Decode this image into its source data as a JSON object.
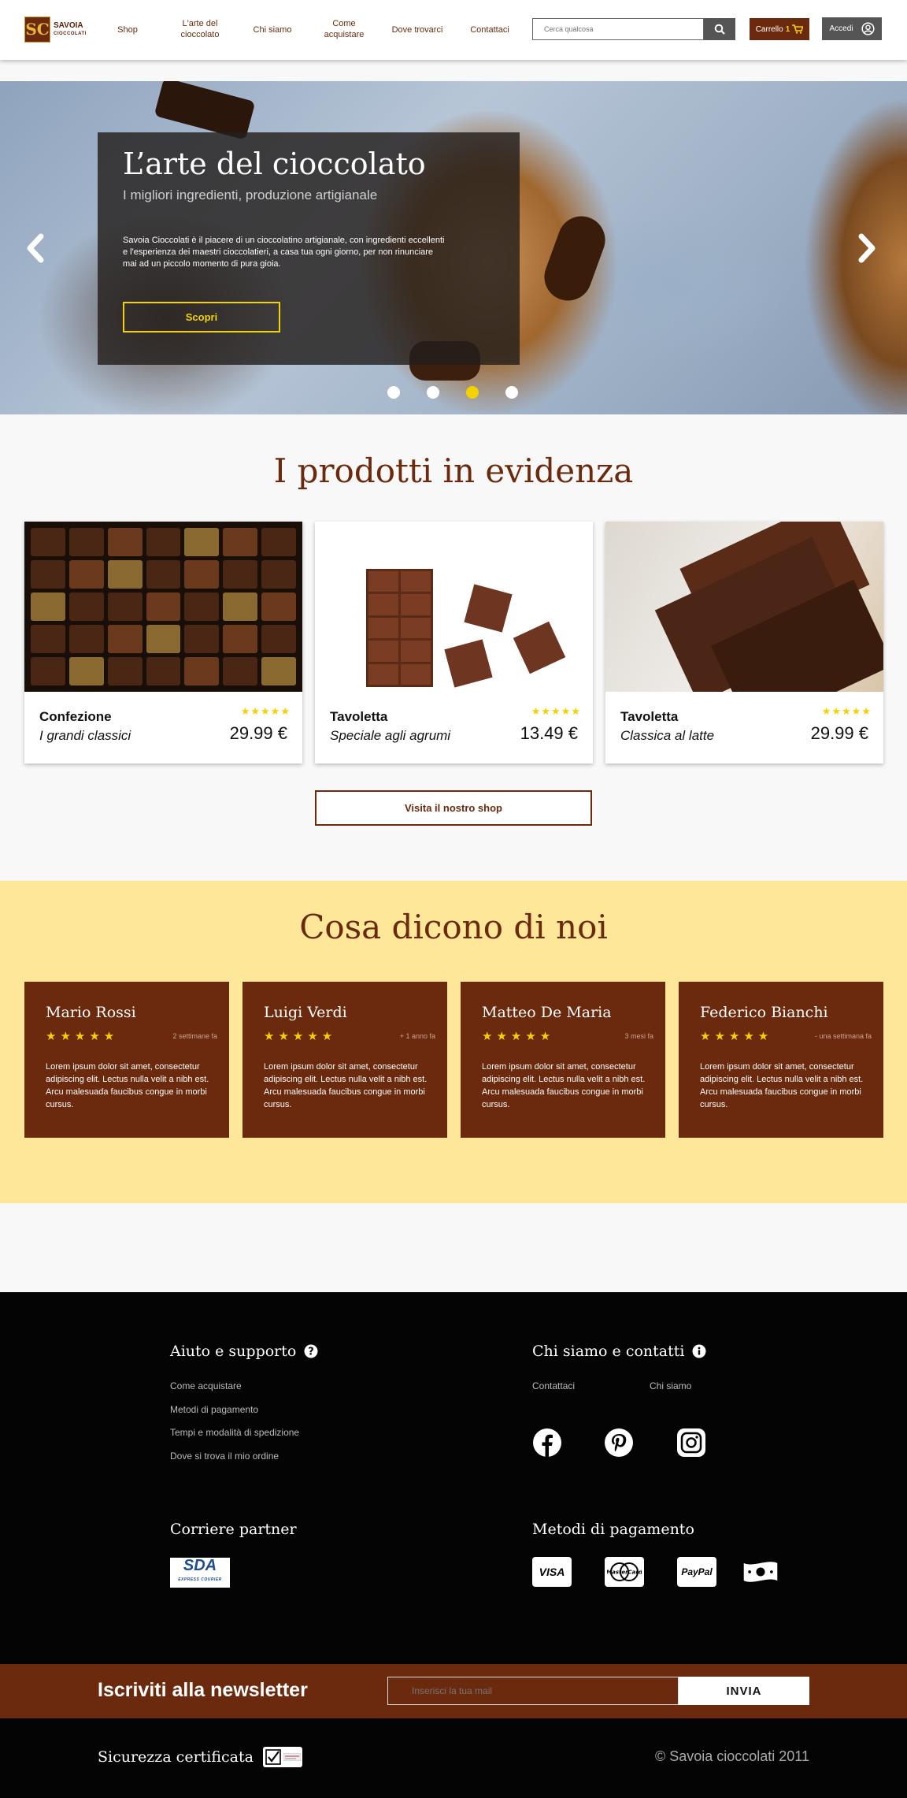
{
  "header": {
    "logo_name": "SAVOIA",
    "logo_sub": "CIOCCOLATI",
    "logo_mark": "SC",
    "nav": [
      "Shop",
      "L'arte del cioccolato",
      "Chi siamo",
      "Come acquistare",
      "Dove trovarci",
      "Contattaci"
    ],
    "search_placeholder": "Cerca qualcosa",
    "cart_label": "Carrello",
    "cart_count": "1",
    "login_label": "Accedi"
  },
  "hero": {
    "title": "L’arte del cioccolato",
    "subtitle": "I migliori ingredienti, produzione artigianale",
    "text": "Savoia Cioccolati è il piacere di un cioccolatino artigianale, con ingredienti eccellenti e l'esperienza dei maestri cioccolatieri, a casa tua ogni giorno, per non rinunciare mai ad un piccolo momento di pura gioia.",
    "button": "Scopri",
    "slides": 4,
    "active_slide": 3
  },
  "featured": {
    "title": "I prodotti in evidenza",
    "products": [
      {
        "name": "Confezione",
        "desc": " I grandi classici",
        "price": "29.99 €",
        "rating": 5
      },
      {
        "name": "Tavoletta",
        "desc": "Speciale agli agrumi",
        "price": "13.49 €",
        "rating": 5
      },
      {
        "name": "Tavoletta",
        "desc": "Classica al latte",
        "price": "29.99 €",
        "rating": 5
      }
    ],
    "shop_button": "Visita il nostro shop"
  },
  "reviews": {
    "title": "Cosa dicono di noi",
    "items": [
      {
        "name": "Mario Rossi",
        "time": "2 settimane fa",
        "rating": 5,
        "text": "Lorem ipsum dolor sit amet, consectetur adipiscing elit. Lectus nulla velit a nibh est. Arcu malesuada faucibus congue in morbi cursus."
      },
      {
        "name": "Luigi Verdi",
        "time": "+ 1 anno fa",
        "rating": 5,
        "text": "Lorem ipsum dolor sit amet, consectetur adipiscing elit. Lectus nulla velit a nibh est. Arcu malesuada faucibus congue in morbi cursus."
      },
      {
        "name": "Matteo De Maria",
        "time": "3 mesi fa",
        "rating": 5,
        "text": "Lorem ipsum dolor sit amet, consectetur adipiscing elit. Lectus nulla velit a nibh est. Arcu malesuada faucibus congue in morbi cursus."
      },
      {
        "name": "Federico Bianchi",
        "time": "- una settimana fa",
        "rating": 5,
        "text": "Lorem ipsum dolor sit amet, consectetur adipiscing elit. Lectus nulla velit a nibh est. Arcu malesuada faucibus congue in morbi cursus."
      }
    ]
  },
  "footer": {
    "help_title": "Aiuto e supporto",
    "help_links": [
      "Come acquistare",
      "Metodi di pagamento",
      "Tempi e modalità di spedizione",
      "Dove si trova il mio ordine"
    ],
    "about_title": "Chi siamo e contatti",
    "about_links": [
      "Contattaci",
      "Chi siamo"
    ],
    "social": [
      "facebook-icon",
      "pinterest-icon",
      "instagram-icon"
    ],
    "courier_title": "Corriere partner",
    "courier_name": "SDA",
    "courier_sub": "EXPRESS COURIER",
    "payment_title": "Metodi di pagamento",
    "payments": [
      "VISA",
      "MasterCard",
      "PayPal",
      "cash-icon"
    ]
  },
  "newsletter": {
    "title": "Iscriviti alla newsletter",
    "placeholder": "Inserisci la tua mail",
    "button": "INVIA"
  },
  "bottom": {
    "security": "Sicurezza certificata",
    "copyright": "© Savoia cioccolati 2011"
  },
  "colors": {
    "brand": "#6b2a0d",
    "accent": "#f2d200",
    "reviews_bg": "#fee799",
    "footer_bg": "#040404"
  }
}
